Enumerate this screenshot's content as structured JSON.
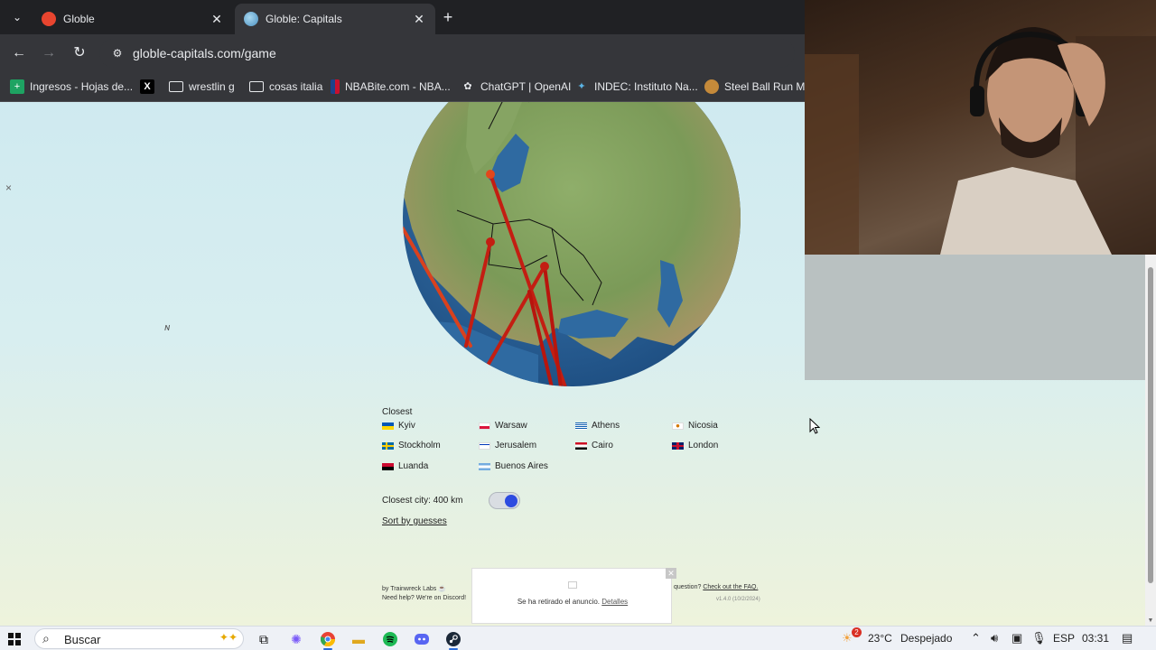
{
  "browser": {
    "tabs": [
      {
        "label": "Globle",
        "active": false,
        "favicon_color": "#e8452f"
      },
      {
        "label": "Globle: Capitals",
        "active": true,
        "favicon_color": "#7ec0e8"
      }
    ],
    "tab_close": "✕",
    "new_tab": "+",
    "url": "globle-capitals.com/game",
    "bookmarks": [
      {
        "label": "Ingresos - Hojas de...",
        "icon": "sheets-icon",
        "color": "#1ea362"
      },
      {
        "label": "",
        "icon": "x-icon",
        "color": "#000000"
      },
      {
        "label": "wrestlin g",
        "icon": "folder-icon",
        "color": "#e8eaed"
      },
      {
        "label": "cosas italia",
        "icon": "folder-icon",
        "color": "#e8eaed"
      },
      {
        "label": "NBABite.com - NBA...",
        "icon": "nba-icon",
        "color": "#c8102e"
      },
      {
        "label": "ChatGPT | OpenAI",
        "icon": "openai-icon",
        "color": "#e8eaed"
      },
      {
        "label": "INDEC: Instituto Na...",
        "icon": "indec-icon",
        "color": "#5bb4e5"
      },
      {
        "label": "Steel Ball Run Man",
        "icon": "sbr-icon",
        "color": "#c58a3a"
      }
    ]
  },
  "game": {
    "close_x": "×",
    "closest_title": "Closest",
    "guesses": [
      {
        "name": "Kyiv",
        "flag": [
          "#0057b7",
          "#ffd700"
        ]
      },
      {
        "name": "Warsaw",
        "flag": [
          "#ffffff",
          "#dc143c"
        ]
      },
      {
        "name": "Athens",
        "flag": [
          "#0d5eaf",
          "#ffffff"
        ]
      },
      {
        "name": "Nicosia",
        "flag": [
          "#ffffff",
          "#d57800"
        ]
      },
      {
        "name": "Stockholm",
        "flag": [
          "#006aa7",
          "#fecc00"
        ]
      },
      {
        "name": "Jerusalem",
        "flag": [
          "#ffffff",
          "#0038b8"
        ]
      },
      {
        "name": "Cairo",
        "flag": [
          "#ce1126",
          "#000000"
        ]
      },
      {
        "name": "London",
        "flag": [
          "#012169",
          "#c8102e"
        ]
      },
      {
        "name": "Luanda",
        "flag": [
          "#cc092f",
          "#000000"
        ]
      },
      {
        "name": "Buenos Aires",
        "flag": [
          "#74acdf",
          "#ffffff"
        ]
      }
    ],
    "closest_city_label": "Closest city: 400  km",
    "sort_link": "Sort by guesses",
    "footer_left_1": "by Trainwreck Labs",
    "footer_left_2": "Need help? We're on Discord!",
    "footer_right_prefix": "question?",
    "footer_right_link": "Check out the FAQ.",
    "version": "v1.4.0 (10/2/2024)",
    "ad_text": "Se ha retirado el anuncio.",
    "ad_link": "Detalles"
  },
  "taskbar": {
    "search_placeholder": "Buscar",
    "weather_temp": "23°C",
    "weather_desc": "Despejado",
    "weather_badge": "2",
    "language": "ESP",
    "time": "03:31"
  }
}
